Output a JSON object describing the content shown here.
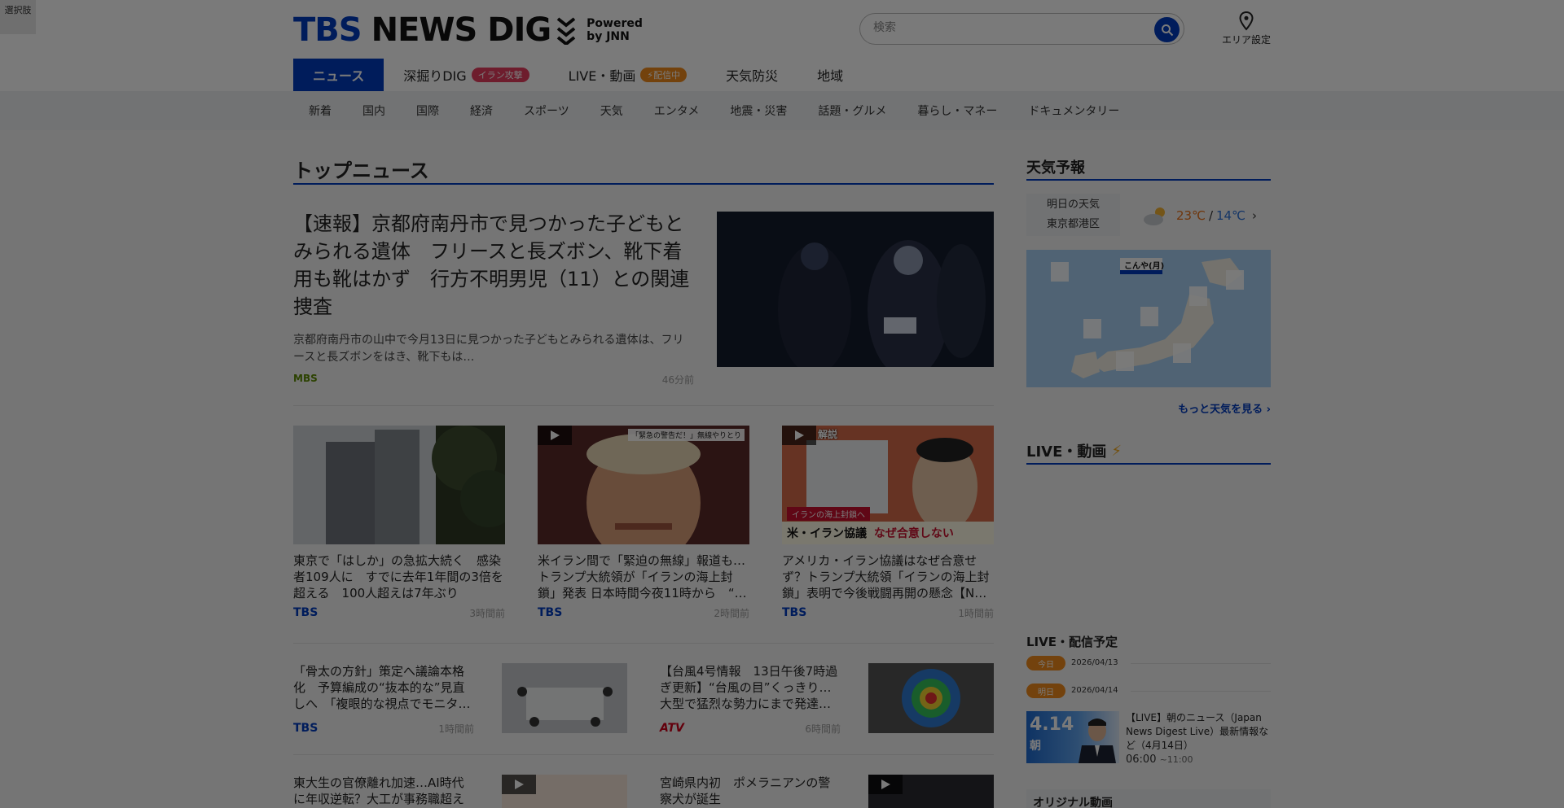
{
  "corner_button": "選択肢",
  "logo": {
    "tbs": "TBS",
    "news_dig": "NEWS DIG",
    "powered_line1": "Powered",
    "powered_line2": "by JNN"
  },
  "search": {
    "placeholder": "検索"
  },
  "area_setting": "エリア設定",
  "main_nav": [
    {
      "label": "ニュース",
      "active": true
    },
    {
      "label": "深掘りDIG",
      "badge": "イラン攻撃"
    },
    {
      "label": "LIVE・動画",
      "badge": "配信中"
    },
    {
      "label": "天気防災"
    },
    {
      "label": "地域"
    }
  ],
  "sub_nav": [
    "新着",
    "国内",
    "国際",
    "経済",
    "スポーツ",
    "天気",
    "エンタメ",
    "地震・災害",
    "話題・グルメ",
    "暮らし・マネー",
    "ドキュメンタリー"
  ],
  "top_news": {
    "heading": "トップニュース",
    "lead": {
      "title": "【速報】京都府南丹市で見つかった子どもとみられる遺体　フリースと長ズボン、靴下着用も靴はかず　行方不明男児（11）との関連捜査",
      "desc": "京都府南丹市の山中で今月13日に見つかった子どもとみられる遺体は、フリースと長ズボンをはき、靴下もは…",
      "source": "MBS",
      "time": "46分前"
    },
    "cards": [
      {
        "title": "東京で「はしか」の急拡大続く　感染者109人に　すでに去年1年間の3倍を超える　100人超えは7年ぶり",
        "source": "TBS",
        "time": "3時間前"
      },
      {
        "title": "米イラン間で「緊迫の無線」報道も…トランプ大統領が「イランの海上封鎖」発表 日本時間今夜11時から　“…",
        "source": "TBS",
        "time": "2時間前",
        "thumb_caption": "「緊急の警告だ！」無線やりとり"
      },
      {
        "title": "アメリカ・イラン協議はなぜ合意せず？トランプ大統領「イランの海上封鎖」表明で今後戦闘再開の懸念【N…",
        "source": "TBS",
        "time": "1時間前",
        "thumb_tag": "解説",
        "thumb_banner1": "イランの海上封鎖へ",
        "thumb_banner2a": "米・イラン協議",
        "thumb_banner2b": "なぜ合意しない"
      }
    ],
    "rows": [
      {
        "title": "「骨太の方針」策定へ議論本格化　予算編成の“抜本的な”見直しへ　「複眼的な視点でモニタ…",
        "source": "TBS",
        "time": "1時間前"
      },
      {
        "title": "【台風4号情報　13日午後7時過ぎ更新】“台風の目”くっきり…大型で猛烈な勢力にまで発達…",
        "source": "ATV",
        "time": "6時間前"
      },
      {
        "title": "東大生の官僚離れ加速…AI時代に年収逆転？大工が事務職超え",
        "source": "",
        "time": ""
      },
      {
        "title": "宮崎県内初　ポメラニアンの警察犬が誕生",
        "source": "",
        "time": ""
      }
    ]
  },
  "weather": {
    "heading": "天気予報",
    "box_line1": "明日の天気",
    "box_line2": "東京都港区",
    "high": "23℃",
    "sep": "/",
    "low": "14℃",
    "map_label": "こんや(月)",
    "more": "もっと天気を見る"
  },
  "live": {
    "heading": "LIVE・動画",
    "schedule_heading": "LIVE・配信予定",
    "days": [
      {
        "pill": "今日",
        "date": "2026/04/13"
      },
      {
        "pill": "明日",
        "date": "2026/04/14"
      }
    ],
    "item": {
      "thumb_date": "4.14",
      "thumb_sub": "朝",
      "title": "【LIVE】朝のニュース（Japan News Digest Live）最新情報など（4月14日）",
      "start": "06:00",
      "end": "~11:00"
    }
  },
  "original_video": {
    "heading": "オリジナル動画"
  },
  "colors": {
    "brand": "#003bbf",
    "badge_red": "#e53e5e",
    "badge_orange": "#f08a1c",
    "temp_high": "#e8711a",
    "temp_low": "#2a6fd6",
    "source_mbs": "#5c8a00",
    "source_atv": "#d0021b"
  }
}
